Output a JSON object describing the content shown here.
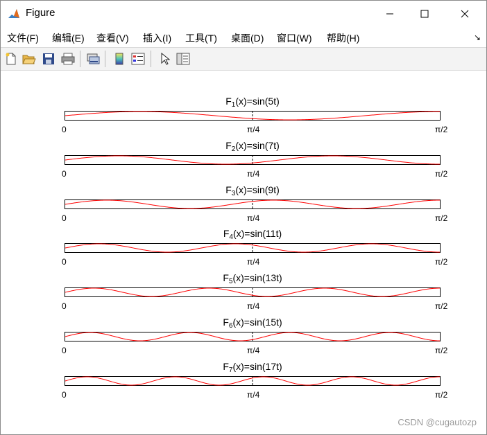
{
  "window": {
    "title": "Figure"
  },
  "menu": [
    {
      "label": "文件(F)"
    },
    {
      "label": "编辑(E)"
    },
    {
      "label": "查看(V)"
    },
    {
      "label": "插入(I)"
    },
    {
      "label": "工具(T)"
    },
    {
      "label": "桌面(D)"
    },
    {
      "label": "窗口(W)"
    },
    {
      "label": "帮助(H)"
    }
  ],
  "menu_overflow_icon": "dock-arrow-icon",
  "toolbar": [
    {
      "icon": "new-figure-icon"
    },
    {
      "icon": "open-file-icon"
    },
    {
      "icon": "save-icon"
    },
    {
      "icon": "print-icon"
    },
    {
      "icon": "link-plot-icon"
    },
    {
      "icon": "colorbar-icon"
    },
    {
      "icon": "legend-icon"
    },
    {
      "icon": "pointer-icon"
    },
    {
      "icon": "property-editor-icon"
    }
  ],
  "chart_data": [
    {
      "type": "line",
      "title_prefix": "F",
      "subscript": "1",
      "title_suffix": "(x)=sin(5t)",
      "frequency": 5,
      "xlim": [
        "0",
        "π/2"
      ],
      "xticks": [
        "0",
        "π/4",
        "π/2"
      ],
      "series_color": "#ff0000"
    },
    {
      "type": "line",
      "title_prefix": "F",
      "subscript": "2",
      "title_suffix": "(x)=sin(7t)",
      "frequency": 7,
      "xlim": [
        "0",
        "π/2"
      ],
      "xticks": [
        "0",
        "π/4",
        "π/2"
      ],
      "series_color": "#ff0000"
    },
    {
      "type": "line",
      "title_prefix": "F",
      "subscript": "3",
      "title_suffix": "(x)=sin(9t)",
      "frequency": 9,
      "xlim": [
        "0",
        "π/2"
      ],
      "xticks": [
        "0",
        "π/4",
        "π/2"
      ],
      "series_color": "#ff0000"
    },
    {
      "type": "line",
      "title_prefix": "F",
      "subscript": "4",
      "title_suffix": "(x)=sin(11t)",
      "frequency": 11,
      "xlim": [
        "0",
        "π/2"
      ],
      "xticks": [
        "0",
        "π/4",
        "π/2"
      ],
      "series_color": "#ff0000"
    },
    {
      "type": "line",
      "title_prefix": "F",
      "subscript": "5",
      "title_suffix": "(x)=sin(13t)",
      "frequency": 13,
      "xlim": [
        "0",
        "π/2"
      ],
      "xticks": [
        "0",
        "π/4",
        "π/2"
      ],
      "series_color": "#ff0000"
    },
    {
      "type": "line",
      "title_prefix": "F",
      "subscript": "6",
      "title_suffix": "(x)=sin(15t)",
      "frequency": 15,
      "xlim": [
        "0",
        "π/2"
      ],
      "xticks": [
        "0",
        "π/4",
        "π/2"
      ],
      "series_color": "#ff0000"
    },
    {
      "type": "line",
      "title_prefix": "F",
      "subscript": "7",
      "title_suffix": "(x)=sin(17t)",
      "frequency": 17,
      "xlim": [
        "0",
        "π/2"
      ],
      "xticks": [
        "0",
        "π/4",
        "π/2"
      ],
      "series_color": "#ff0000"
    }
  ],
  "watermark": "CSDN @cugautozp"
}
